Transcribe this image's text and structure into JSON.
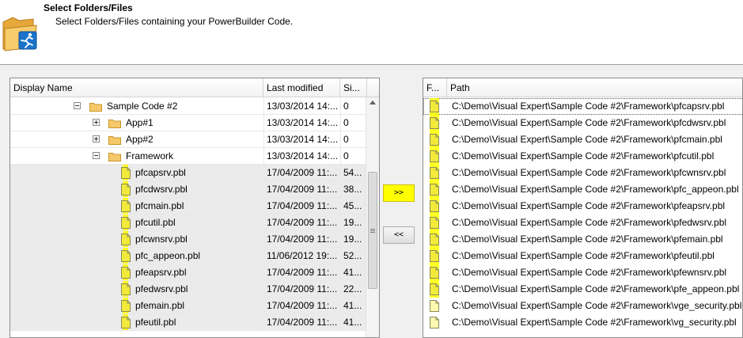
{
  "header": {
    "title": "Select Folders/Files",
    "subtitle": "Select Folders/Files containing your PowerBuilder Code."
  },
  "left": {
    "columns": [
      "Display Name",
      "Last modified",
      "Si..."
    ],
    "rows": [
      {
        "name": "Sample Code #2",
        "modified": "13/03/2014 14:...",
        "size": "0",
        "kind": "folder",
        "expander": "minus"
      },
      {
        "name": "App#1",
        "modified": "13/03/2014 14:...",
        "size": "0",
        "kind": "folder",
        "expander": "plus"
      },
      {
        "name": "App#2",
        "modified": "13/03/2014 14:...",
        "size": "0",
        "kind": "folder",
        "expander": "plus"
      },
      {
        "name": "Framework",
        "modified": "13/03/2014 14:...",
        "size": "0",
        "kind": "folder",
        "expander": "minus"
      },
      {
        "name": "pfcapsrv.pbl",
        "modified": "17/04/2009 11:...",
        "size": "54...",
        "kind": "file"
      },
      {
        "name": "pfcdwsrv.pbl",
        "modified": "17/04/2009 11:...",
        "size": "38...",
        "kind": "file"
      },
      {
        "name": "pfcmain.pbl",
        "modified": "17/04/2009 11:...",
        "size": "45...",
        "kind": "file"
      },
      {
        "name": "pfcutil.pbl",
        "modified": "17/04/2009 11:...",
        "size": "19...",
        "kind": "file"
      },
      {
        "name": "pfcwnsrv.pbl",
        "modified": "17/04/2009 11:...",
        "size": "19...",
        "kind": "file"
      },
      {
        "name": "pfc_appeon.pbl",
        "modified": "11/06/2012 19:...",
        "size": "52...",
        "kind": "file"
      },
      {
        "name": "pfeapsrv.pbl",
        "modified": "17/04/2009 11:...",
        "size": "41...",
        "kind": "file"
      },
      {
        "name": "pfedwsrv.pbl",
        "modified": "17/04/2009 11:...",
        "size": "22...",
        "kind": "file"
      },
      {
        "name": "pfemain.pbl",
        "modified": "17/04/2009 11:...",
        "size": "41...",
        "kind": "file"
      },
      {
        "name": "pfeutil.pbl",
        "modified": "17/04/2009 11:...",
        "size": "41...",
        "kind": "file"
      }
    ]
  },
  "buttons": {
    "add": ">>",
    "remove": "<<"
  },
  "right": {
    "columns": [
      "F...",
      "Path"
    ],
    "rows": [
      {
        "path": "C:\\Demo\\Visual Expert\\Sample Code #2\\Framework\\pfcapsrv.pbl",
        "highlight": true
      },
      {
        "path": "C:\\Demo\\Visual Expert\\Sample Code #2\\Framework\\pfcdwsrv.pbl",
        "highlight": true
      },
      {
        "path": "C:\\Demo\\Visual Expert\\Sample Code #2\\Framework\\pfcmain.pbl",
        "highlight": true
      },
      {
        "path": "C:\\Demo\\Visual Expert\\Sample Code #2\\Framework\\pfcutil.pbl",
        "highlight": true
      },
      {
        "path": "C:\\Demo\\Visual Expert\\Sample Code #2\\Framework\\pfcwnsrv.pbl",
        "highlight": true
      },
      {
        "path": "C:\\Demo\\Visual Expert\\Sample Code #2\\Framework\\pfc_appeon.pbl",
        "highlight": true
      },
      {
        "path": "C:\\Demo\\Visual Expert\\Sample Code #2\\Framework\\pfeapsrv.pbl",
        "highlight": true
      },
      {
        "path": "C:\\Demo\\Visual Expert\\Sample Code #2\\Framework\\pfedwsrv.pbl",
        "highlight": true
      },
      {
        "path": "C:\\Demo\\Visual Expert\\Sample Code #2\\Framework\\pfemain.pbl",
        "highlight": true
      },
      {
        "path": "C:\\Demo\\Visual Expert\\Sample Code #2\\Framework\\pfeutil.pbl",
        "highlight": true
      },
      {
        "path": "C:\\Demo\\Visual Expert\\Sample Code #2\\Framework\\pfewnsrv.pbl",
        "highlight": true
      },
      {
        "path": "C:\\Demo\\Visual Expert\\Sample Code #2\\Framework\\pfe_appeon.pbl",
        "highlight": true
      },
      {
        "path": "C:\\Demo\\Visual Expert\\Sample Code #2\\Framework\\vge_security.pbl",
        "highlight": false
      },
      {
        "path": "C:\\Demo\\Visual Expert\\Sample Code #2\\Framework\\vg_security.pbl",
        "highlight": false
      }
    ]
  },
  "colors": {
    "highlight": "#ffff00",
    "folder": "#f5c869",
    "file": "#fff8b0"
  },
  "icons": {
    "header": "folder-runner-icon",
    "folder": "folder-icon",
    "file": "pbl-file-icon"
  }
}
